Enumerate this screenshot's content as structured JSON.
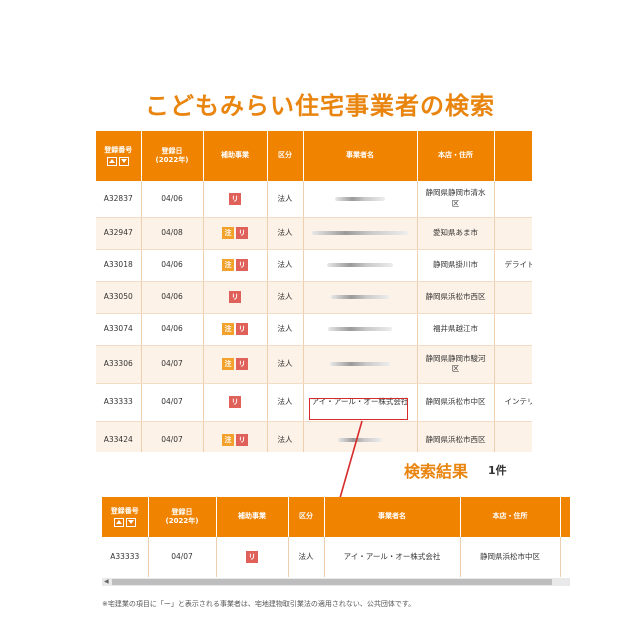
{
  "page": {
    "title": "こどもみらい住宅事業者の検索"
  },
  "colors": {
    "accent": "#f08300",
    "title": "#e9850f",
    "badge_chu": "#f2a22b",
    "badge_ri": "#e0605a",
    "highlight": "#d62b2b"
  },
  "table1": {
    "headers": {
      "reg_no": "登録番号",
      "reg_date_l1": "登録日",
      "reg_date_l2": "(2022年)",
      "subsidy": "補助事業",
      "type": "区分",
      "name": "事業者名",
      "address": "本店・住所",
      "brand": ""
    },
    "rows": [
      {
        "id": "A32837",
        "date": "04/06",
        "chu": false,
        "ri": true,
        "type": "法人",
        "name": "",
        "addr1": "静岡県静岡市清水",
        "addr2": "区",
        "brand": ""
      },
      {
        "id": "A32947",
        "date": "04/08",
        "chu": true,
        "ri": true,
        "type": "法人",
        "name": "",
        "addr1": "愛知県あま市",
        "addr2": "",
        "brand": ""
      },
      {
        "id": "A33018",
        "date": "04/06",
        "chu": true,
        "ri": true,
        "type": "法人",
        "name": "",
        "addr1": "静岡県掛川市",
        "addr2": "",
        "brand": "デライト"
      },
      {
        "id": "A33050",
        "date": "04/06",
        "chu": false,
        "ri": true,
        "type": "法人",
        "name": "",
        "addr1": "静岡県浜松市西区",
        "addr2": "",
        "brand": ""
      },
      {
        "id": "A33074",
        "date": "04/06",
        "chu": true,
        "ri": true,
        "type": "法人",
        "name": "",
        "addr1": "福井県越江市",
        "addr2": "",
        "brand": ""
      },
      {
        "id": "A33306",
        "date": "04/07",
        "chu": true,
        "ri": true,
        "type": "法人",
        "name": "",
        "addr1": "静岡県静岡市駿河",
        "addr2": "区",
        "brand": ""
      },
      {
        "id": "A33333",
        "date": "04/07",
        "chu": false,
        "ri": true,
        "type": "法人",
        "name": "アイ・アール・オー株式会社",
        "addr1": "静岡県浜松市中区",
        "addr2": "",
        "brand": "インテリ"
      },
      {
        "id": "A33424",
        "date": "04/07",
        "chu": true,
        "ri": true,
        "type": "法人",
        "name": "",
        "addr1": "静岡県浜松市西区",
        "addr2": "",
        "brand": ""
      }
    ],
    "badge_chu_label": "注",
    "badge_ri_label": "リ"
  },
  "result": {
    "label": "検索結果",
    "count": "1件"
  },
  "table2": {
    "headers": {
      "reg_no": "登録番号",
      "reg_date_l1": "登録日",
      "reg_date_l2": "(2022年)",
      "subsidy": "補助事業",
      "type": "区分",
      "name": "事業者名",
      "address": "本店・住所"
    },
    "row": {
      "id": "A33333",
      "date": "04/07",
      "ri": "リ",
      "type": "法人",
      "name": "アイ・アール・オー株式会社",
      "addr": "静岡県浜松市中区"
    }
  },
  "footnote": "※宅建業の項目に「ー」と表示される事業者は、宅地建物取引業法の適用されない、公共団体です。"
}
